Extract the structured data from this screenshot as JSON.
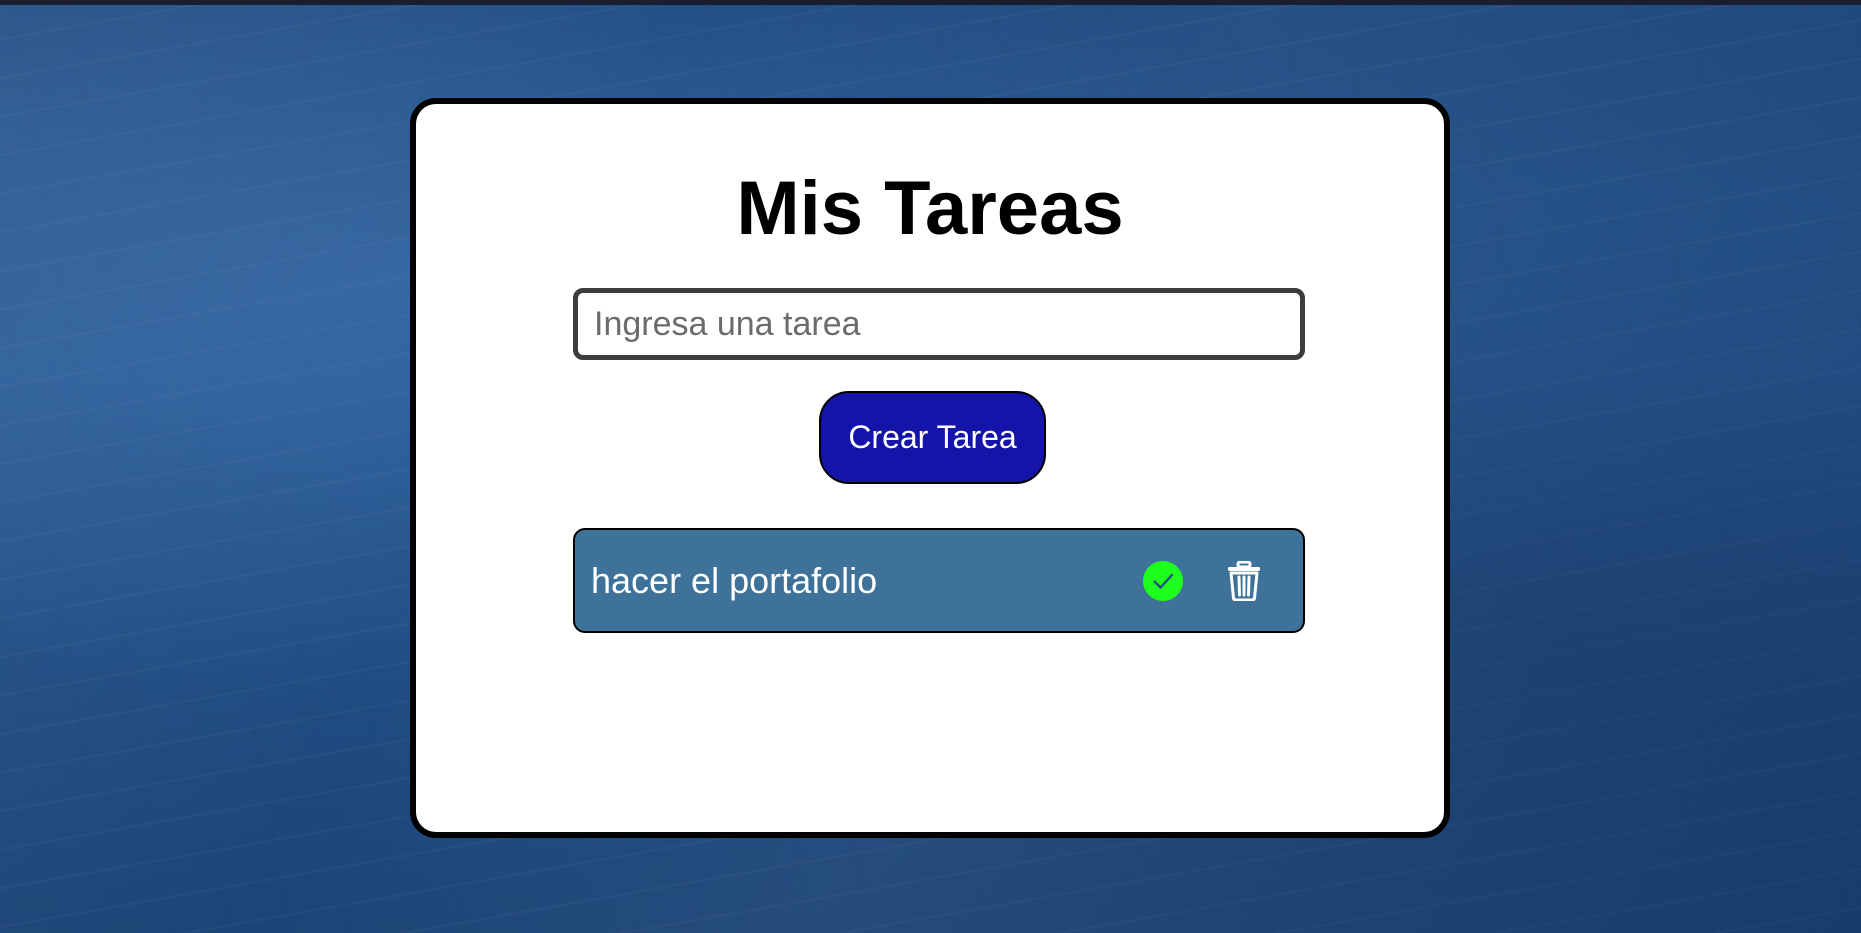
{
  "page": {
    "title": "Mis Tareas"
  },
  "form": {
    "input_value": "",
    "input_placeholder": "Ingresa una tarea",
    "create_label": "Crear Tarea"
  },
  "tasks": [
    {
      "text": "hacer el portafolio",
      "complete_icon": "check-circle-icon",
      "delete_icon": "trash-icon"
    }
  ],
  "colors": {
    "card_background": "#ffffff",
    "create_button": "#1414a8",
    "task_item": "#3e7299",
    "complete_icon": "#1eff1e",
    "delete_icon": "#ffffff",
    "page_background": "#1f4a7c"
  }
}
